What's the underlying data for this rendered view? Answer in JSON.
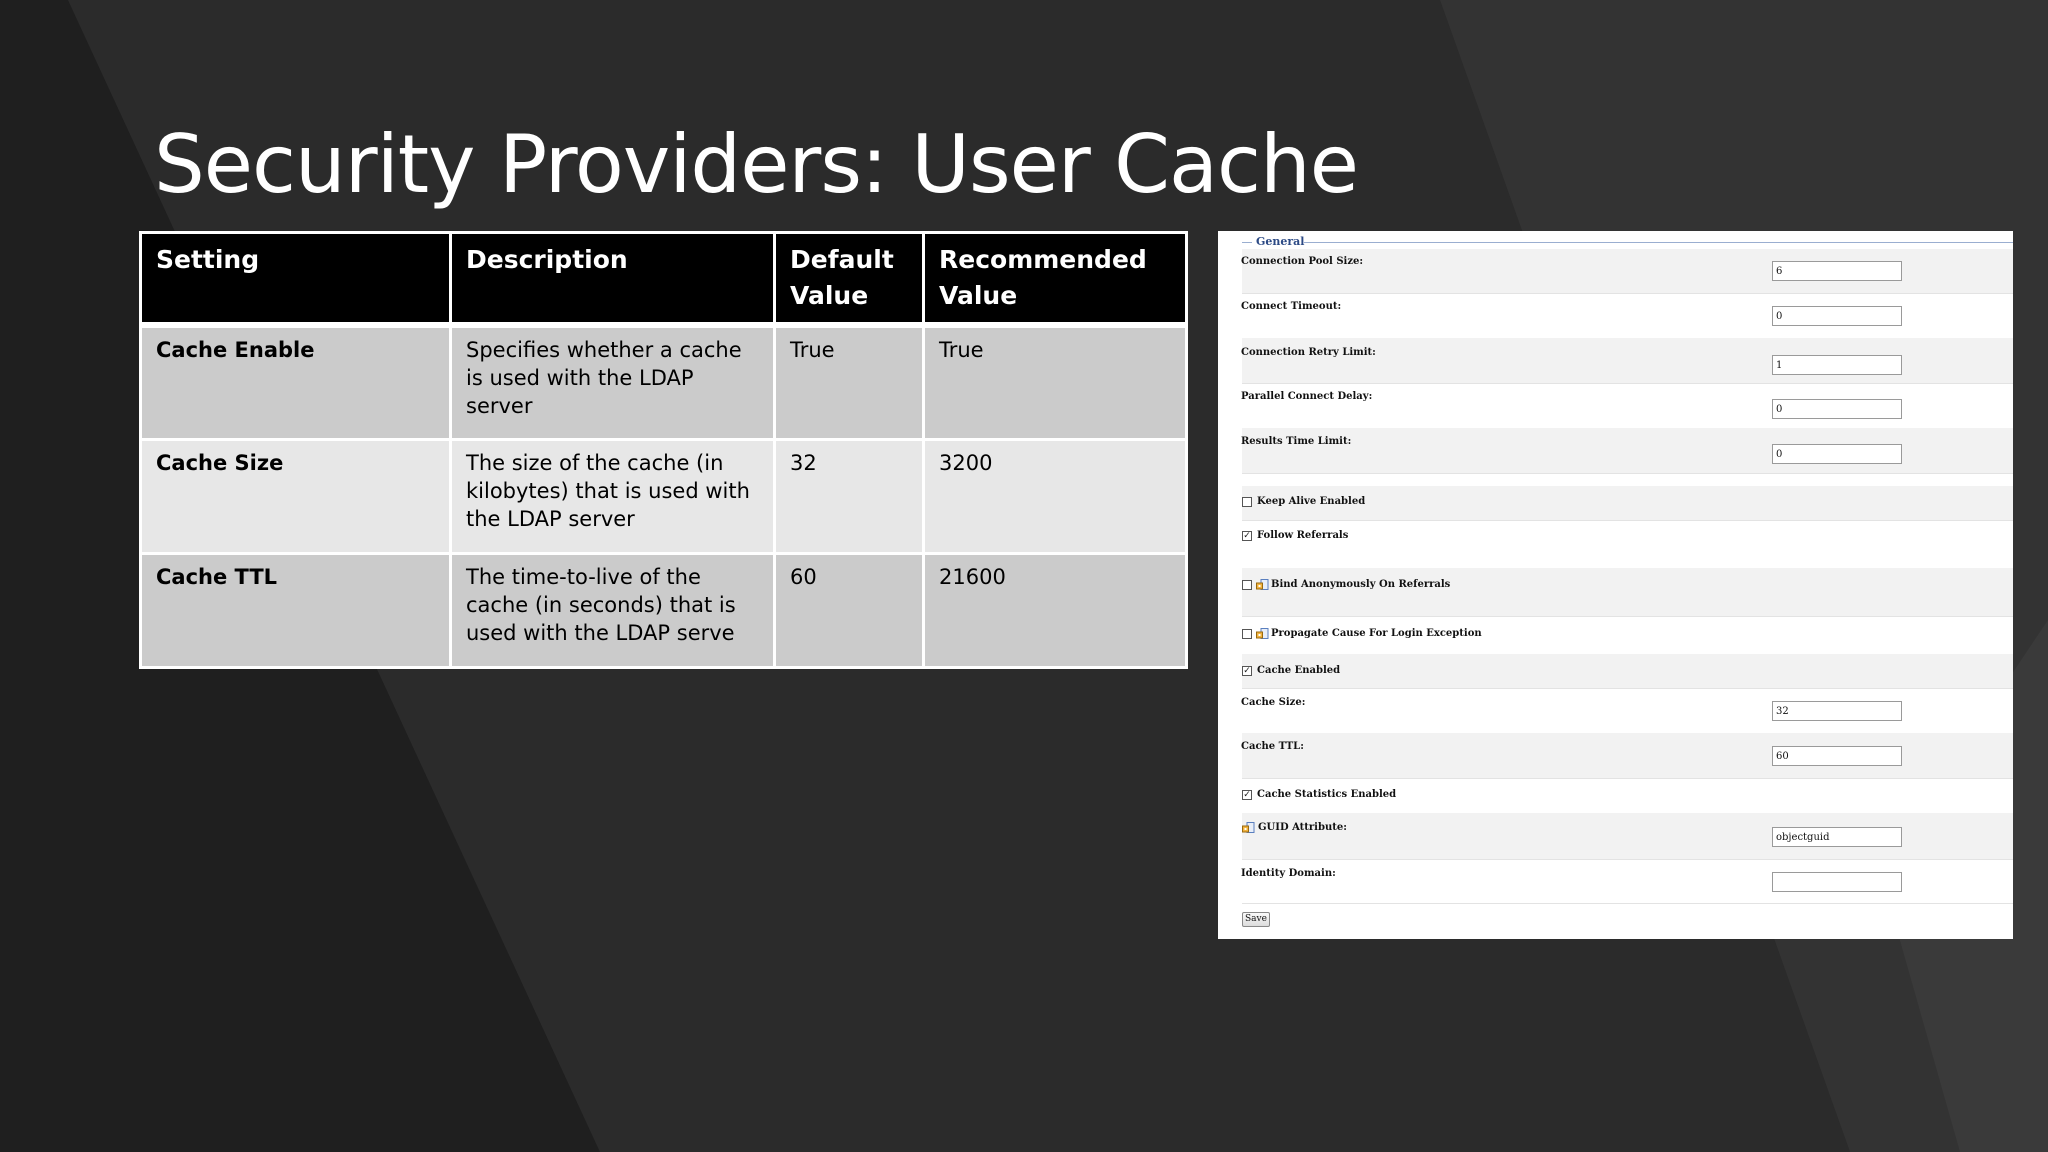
{
  "slide": {
    "title": "Security Providers: User Cache"
  },
  "table": {
    "headers": [
      "Setting",
      "Description",
      "Default Value",
      "Recommended Value"
    ],
    "rows": [
      {
        "setting": "Cache Enable",
        "description": "Specifies whether a cache is used with the LDAP server",
        "default": "True",
        "recommended": "True"
      },
      {
        "setting": "Cache Size",
        "description": "The size of the cache (in kilobytes) that is used with the LDAP server",
        "default": "32",
        "recommended": "3200"
      },
      {
        "setting": "Cache TTL",
        "description": "The time-to-live of the cache (in seconds) that is used with the LDAP serve",
        "default": "60",
        "recommended": "21600"
      }
    ]
  },
  "panel": {
    "legend": "General",
    "connection_pool_size": {
      "label": "Connection Pool Size:",
      "value": "6"
    },
    "connect_timeout": {
      "label": "Connect Timeout:",
      "value": "0"
    },
    "connection_retry_limit": {
      "label": "Connection Retry Limit:",
      "value": "1"
    },
    "parallel_connect_delay": {
      "label": "Parallel Connect Delay:",
      "value": "0"
    },
    "results_time_limit": {
      "label": "Results Time Limit:",
      "value": "0"
    },
    "keep_alive_enabled": {
      "label": "Keep Alive Enabled",
      "checked": false
    },
    "follow_referrals": {
      "label": "Follow Referrals",
      "checked": true
    },
    "bind_anonymously": {
      "label": "Bind Anonymously On Referrals",
      "checked": false
    },
    "propagate_cause": {
      "label": "Propagate Cause For Login Exception",
      "checked": false
    },
    "cache_enabled": {
      "label": "Cache Enabled",
      "checked": true
    },
    "cache_size": {
      "label": "Cache Size:",
      "value": "32"
    },
    "cache_ttl": {
      "label": "Cache TTL:",
      "value": "60"
    },
    "cache_statistics_enabled": {
      "label": "Cache Statistics Enabled",
      "checked": true
    },
    "guid_attribute": {
      "label": "GUID Attribute:",
      "value": "objectguid"
    },
    "identity_domain": {
      "label": "Identity Domain:",
      "value": ""
    },
    "save_label": "Save",
    "check_mark": "✓"
  }
}
